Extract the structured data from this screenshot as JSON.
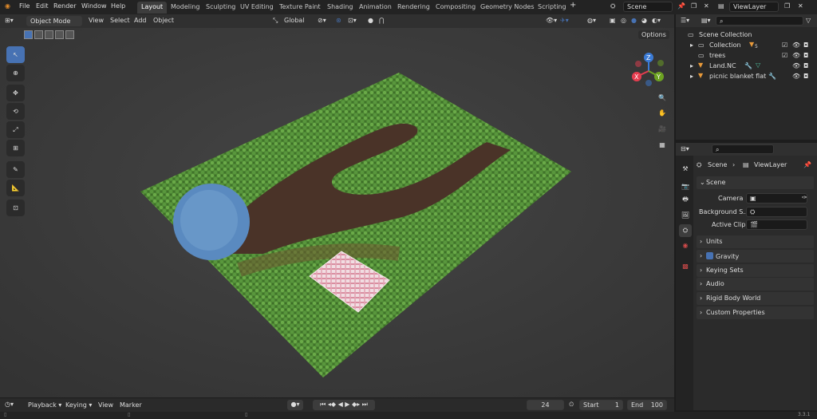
{
  "menu": {
    "file": "File",
    "edit": "Edit",
    "render": "Render",
    "window": "Window",
    "help": "Help"
  },
  "workspaces": [
    "Layout",
    "Modeling",
    "Sculpting",
    "UV Editing",
    "Texture Paint",
    "Shading",
    "Animation",
    "Rendering",
    "Compositing",
    "Geometry Nodes",
    "Scripting"
  ],
  "add_workspace": "+",
  "scene_field": "Scene",
  "viewlayer_field": "ViewLayer",
  "viewport_header": {
    "mode": "Object Mode",
    "view": "View",
    "select": "Select",
    "add": "Add",
    "object": "Object",
    "orientation": "Global",
    "options": "Options"
  },
  "gizmo": {
    "x": "X",
    "y": "Y",
    "z": "Z"
  },
  "outliner": {
    "root": "Scene Collection",
    "rows": [
      {
        "label": "Collection",
        "badge": "5"
      },
      {
        "label": "trees"
      },
      {
        "label": "Land.NC"
      },
      {
        "label": "picnic blanket flat"
      }
    ]
  },
  "properties": {
    "breadcrumb_scene": "Scene",
    "breadcrumb_sep": "›",
    "breadcrumb_viewlayer": "ViewLayer",
    "section": "Scene",
    "camera_label": "Camera",
    "bg_label": "Background S...",
    "clip_label": "Active Clip",
    "panels": [
      "Units",
      "Gravity",
      "Keying Sets",
      "Audio",
      "Rigid Body World",
      "Custom Properties"
    ]
  },
  "timeline": {
    "playback": "Playback",
    "keying": "Keying",
    "view": "View",
    "marker": "Marker",
    "current_frame": "24",
    "start_label": "Start",
    "start": "1",
    "end_label": "End",
    "end": "100"
  },
  "status": {
    "version": "3.3.1"
  },
  "colors": {
    "accent": "#4772b3",
    "axis_x": "#e63d4f",
    "axis_y": "#6da322",
    "axis_z": "#3b7bd6",
    "grass": "#5e9a3f",
    "water": "#4f80b8",
    "path": "#4a3328"
  }
}
